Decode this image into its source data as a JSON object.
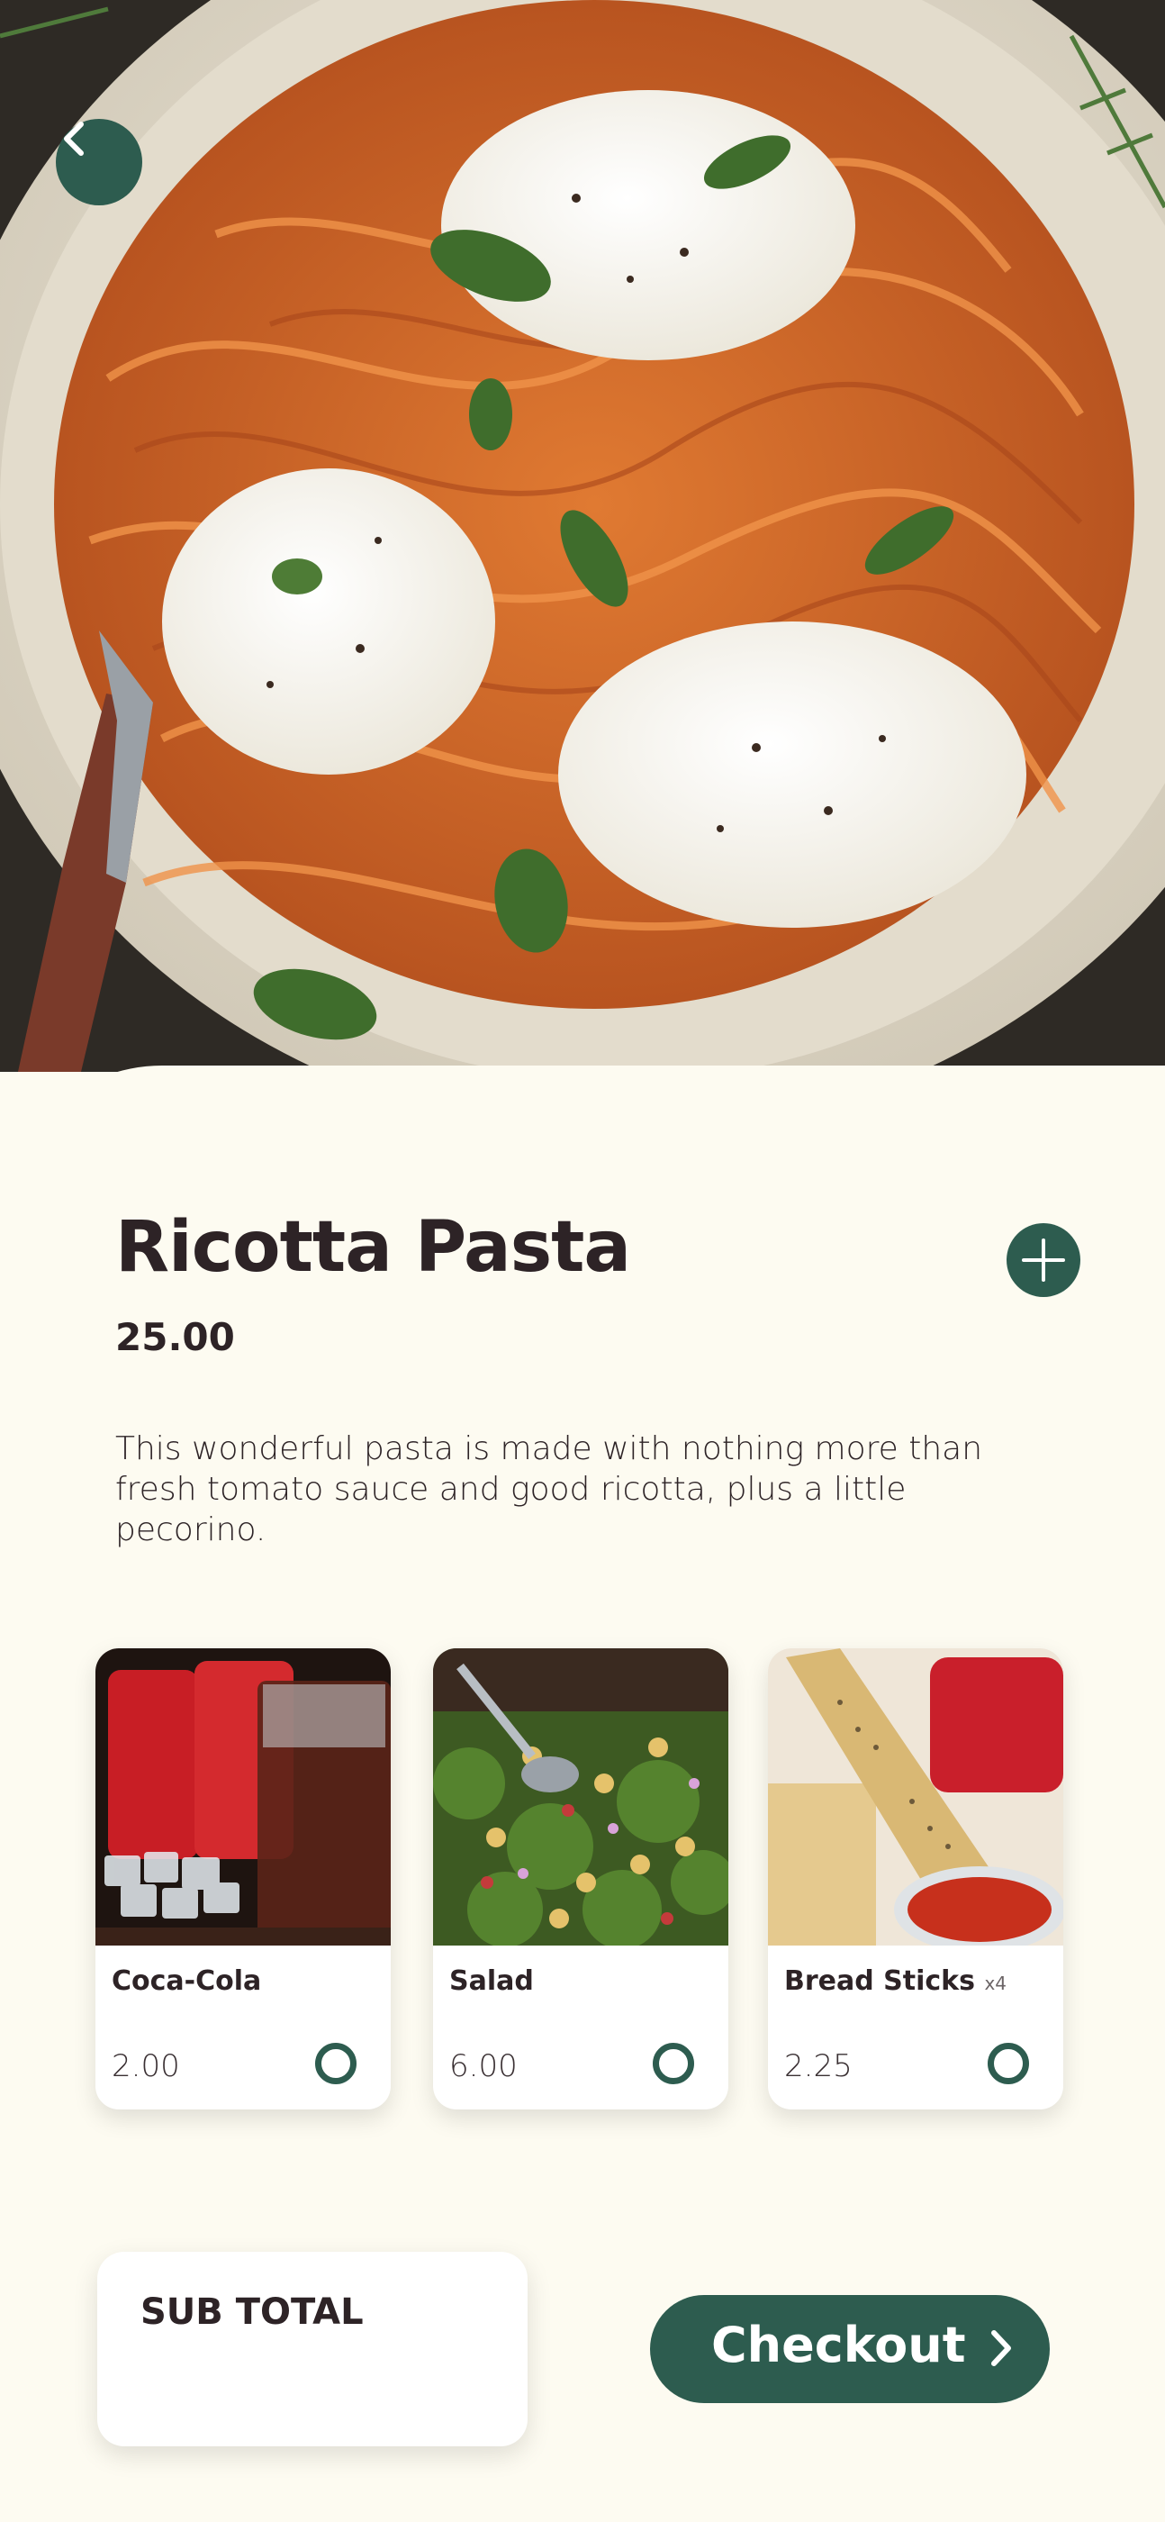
{
  "dish": {
    "name": "Ricotta Pasta",
    "price": "25.00",
    "description": "This wonderful pasta is made with nothing more than fresh tomato sauce and good ricotta, plus a little pecorino."
  },
  "extras": [
    {
      "name": "Coca-Cola",
      "qty": "",
      "price": "2.00",
      "selected": false
    },
    {
      "name": "Salad",
      "qty": "",
      "price": "6.00",
      "selected": false
    },
    {
      "name": "Bread Sticks",
      "qty": "x4",
      "price": "2.25",
      "selected": false
    }
  ],
  "footer": {
    "subtotal_label": "SUB TOTAL",
    "checkout_label": "Checkout"
  },
  "icons": {
    "back": "chevron-left-icon",
    "add": "plus-icon",
    "checkout": "chevron-right-icon"
  },
  "colors": {
    "accent": "#2d5c4f",
    "background": "#fdfbf1",
    "text": "#2d2326"
  }
}
